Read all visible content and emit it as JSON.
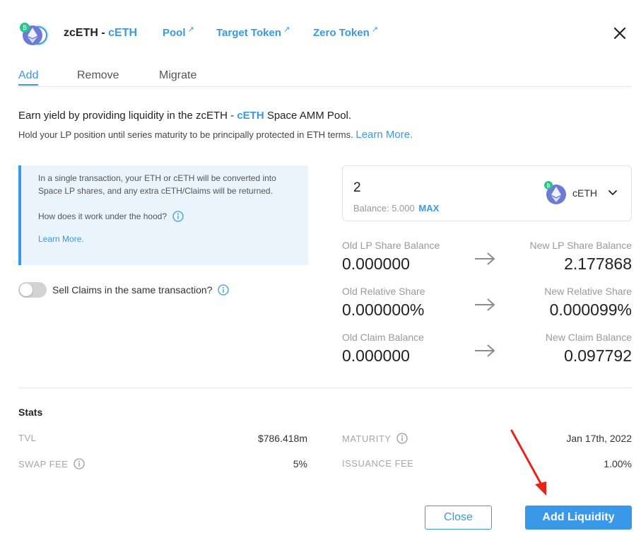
{
  "header": {
    "pair_base": "zcETH",
    "pair_sep": " - ",
    "pair_quote": "cETH",
    "links": [
      {
        "label": "Pool",
        "ext": "↗"
      },
      {
        "label": "Target Token",
        "ext": "↗"
      },
      {
        "label": "Zero Token",
        "ext": "↗"
      }
    ]
  },
  "tabs": [
    {
      "label": "Add",
      "active": true
    },
    {
      "label": "Remove",
      "active": false
    },
    {
      "label": "Migrate",
      "active": false
    }
  ],
  "intro": {
    "line1_pre": "Earn yield by providing liquidity in the zcETH - ",
    "line1_accent": "cETH",
    "line1_post": " Space AMM Pool.",
    "line2": "Hold your LP position until series maturity to be principally protected in ETH terms.",
    "learn_more": "Learn More."
  },
  "infobox": {
    "text": "In a single transaction, your ETH or cETH will be converted into Space LP shares, and any extra cETH/Claims will be returned.",
    "hood": "How does it work under the hood?",
    "learn_more": "Learn More."
  },
  "toggle": {
    "label": "Sell Claims in the same transaction?",
    "on": false
  },
  "amount": {
    "value": "2",
    "balance_label": "Balance: 5.000",
    "max": "MAX",
    "token": "cETH"
  },
  "balances": [
    {
      "old_label": "Old LP Share Balance",
      "old_value": "0.000000",
      "new_label": "New LP Share Balance",
      "new_value": "2.177868"
    },
    {
      "old_label": "Old Relative Share",
      "old_value": "0.000000%",
      "new_label": "New Relative Share",
      "new_value": "0.000099%"
    },
    {
      "old_label": "Old Claim Balance",
      "old_value": "0.000000",
      "new_label": "New Claim Balance",
      "new_value": "0.097792"
    }
  ],
  "stats": {
    "title": "Stats",
    "tvl_label": "TVL",
    "tvl_value": "$786.418m",
    "swap_fee_label": "SWAP FEE",
    "swap_fee_value": "5%",
    "maturity_label": "MATURITY",
    "maturity_value": "Jan 17th, 2022",
    "issuance_fee_label": "ISSUANCE FEE",
    "issuance_fee_value": "1.00%"
  },
  "buttons": {
    "close": "Close",
    "add_liquidity": "Add Liquidity"
  },
  "colors": {
    "accent": "#3a98e8",
    "annotation_arrow": "#e8231a",
    "eth_purple": "#6b7bd6",
    "badge_green": "#2bc48a"
  }
}
